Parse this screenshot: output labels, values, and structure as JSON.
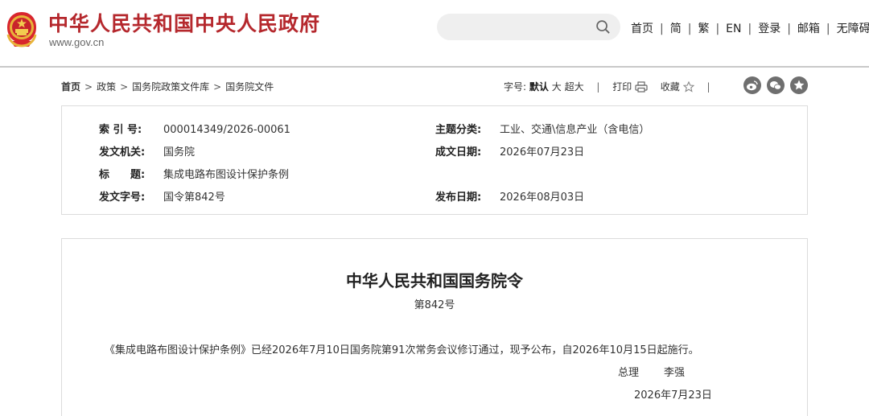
{
  "header": {
    "site_title": "中华人民共和国中央人民政府",
    "site_url": "www.gov.cn",
    "search_placeholder": "",
    "nav": [
      {
        "label": "首页"
      },
      {
        "label": "简"
      },
      {
        "label": "繁"
      },
      {
        "label": "EN"
      },
      {
        "label": "登录"
      },
      {
        "label": "邮箱"
      },
      {
        "label": "无障碍"
      }
    ]
  },
  "breadcrumb": {
    "items": [
      "首页",
      "政策",
      "国务院政策文件库",
      "国务院文件"
    ]
  },
  "tools": {
    "font_size_label": "字号:",
    "font_default": "默认",
    "font_large": "大",
    "font_xlarge": "超大",
    "print_label": "打印",
    "favorite_label": "收藏"
  },
  "meta": {
    "index_label": "索 引 号:",
    "index_value": "000014349/2026-00061",
    "topic_label": "主题分类:",
    "topic_value": "工业、交通\\信息产业（含电信）",
    "issuer_label": "发文机关:",
    "issuer_value": "国务院",
    "written_date_label": "成文日期:",
    "written_date_value": "2026年07月23日",
    "title_label": "标　　题:",
    "title_value": "集成电路布图设计保护条例",
    "doc_no_label": "发文字号:",
    "doc_no_value": "国令第842号",
    "publish_date_label": "发布日期:",
    "publish_date_value": "2026年08月03日"
  },
  "document": {
    "title": "中华人民共和国国务院令",
    "number": "第842号",
    "body": "《集成电路布图设计保护条例》已经2026年7月10日国务院第91次常务会议修订通过，现予公布，自2026年10月15日起施行。",
    "signer_role": "总理",
    "signer_name": "李强",
    "sign_date": "2026年7月23日"
  },
  "colors": {
    "brand_red": "#b5282d",
    "icon_gray": "#6f6f6f"
  }
}
